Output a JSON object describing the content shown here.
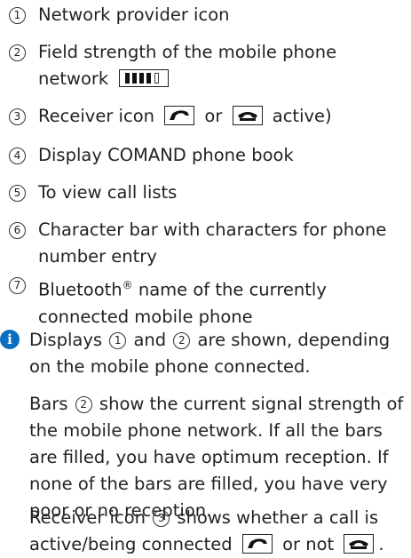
{
  "legend": [
    {
      "num": "1",
      "text": "Network provider icon"
    },
    {
      "num": "2",
      "text": "Field strength of the mobile phone network"
    },
    {
      "num": "3",
      "text_a": "Receiver icon",
      "text_b": "or",
      "text_c": "active)"
    },
    {
      "num": "4",
      "text": "Display COMAND phone book"
    },
    {
      "num": "5",
      "text": "To view call lists"
    },
    {
      "num": "6",
      "text": "Character bar with characters for phone number entry"
    },
    {
      "num": "7",
      "text_a": "Bluetooth",
      "text_sup": "®",
      "text_b": "name of the currently connected mobile phone"
    }
  ],
  "note": {
    "icon": "info-icon",
    "icon_color": "#0a6fc2",
    "p1": {
      "a": "Displays",
      "n1": "1",
      "b": "and",
      "n2": "2",
      "c": "are shown, depending on the mobile phone connected."
    },
    "p2": {
      "a": "Bars",
      "n": "2",
      "b": "show the current signal strength of the mobile phone network. If all the bars are filled, you have optimum reception. If none of the bars are filled, you have very poor or no reception."
    },
    "p3": {
      "a": "Receiver icon",
      "n": "3",
      "b": "shows whether a call is active/being connected",
      "c": "or not",
      "d": "."
    }
  }
}
